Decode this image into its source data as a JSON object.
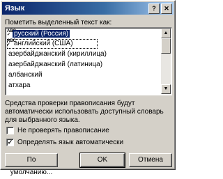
{
  "window": {
    "title": "Язык",
    "help_glyph": "?",
    "close_glyph": "✕"
  },
  "prompt_label": "Пометить выделенный текст как:",
  "languages": [
    {
      "label": "русский (Россия)",
      "selected": true,
      "spell_icon": true
    },
    {
      "label": "английский (США)",
      "selected": false,
      "spell_icon": true
    },
    {
      "label": "азербайджанский (кириллица)",
      "selected": false,
      "spell_icon": false
    },
    {
      "label": "азербайджанский (латиница)",
      "selected": false,
      "spell_icon": false
    },
    {
      "label": "албанский",
      "selected": false,
      "spell_icon": false
    },
    {
      "label": "атхара",
      "selected": false,
      "spell_icon": false
    }
  ],
  "description": "Средства проверки правописания будут автоматически использовать доступный словарь для выбранного языка.",
  "options": {
    "no_spellcheck": {
      "label": "Не проверять правописание",
      "checked": false
    },
    "auto_detect": {
      "label": "Определять язык автоматически",
      "checked": true
    }
  },
  "buttons": {
    "default_label": "По умолчанию...",
    "ok_label": "OK",
    "cancel_label": "Отмена"
  },
  "scroll": {
    "up": "▲",
    "down": "▼"
  },
  "colors": {
    "titlebar_start": "#0a246a",
    "dialog_face": "#d4d0c8",
    "selection": "#0a246a"
  }
}
